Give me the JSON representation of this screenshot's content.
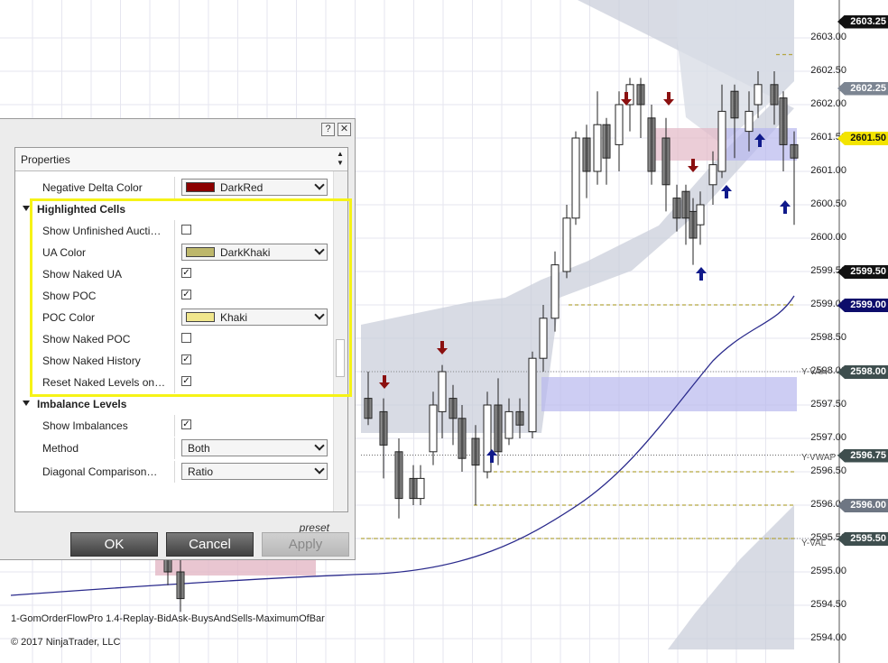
{
  "chart": {
    "price_axis": [
      "2603.00",
      "2602.50",
      "2602.00",
      "2601.50",
      "2601.00",
      "2600.50",
      "2600.00",
      "2599.50",
      "2599.00",
      "2598.50",
      "2598.00",
      "2597.50",
      "2597.00",
      "2596.50",
      "2596.00",
      "2595.50",
      "2595.00",
      "2594.50",
      "2594.00"
    ],
    "price_tags": [
      {
        "label": "2603.25",
        "bg": "#111111",
        "fg": "#ffffff"
      },
      {
        "label": "2602.25",
        "bg": "#7c8592",
        "fg": "#ffffff"
      },
      {
        "label": "2601.50",
        "bg": "#f3e400",
        "fg": "#111111"
      },
      {
        "label": "2599.50",
        "bg": "#111111",
        "fg": "#ffffff"
      },
      {
        "label": "2599.00",
        "bg": "#0d0d6b",
        "fg": "#ffffff"
      },
      {
        "label": "2598.00",
        "bg": "#3e4e4e",
        "fg": "#ffffff"
      },
      {
        "label": "2596.75",
        "bg": "#3e4e4e",
        "fg": "#ffffff"
      },
      {
        "label": "2596.00",
        "bg": "#6e7683",
        "fg": "#ffffff"
      },
      {
        "label": "2595.50",
        "bg": "#3e4e4e",
        "fg": "#ffffff"
      }
    ],
    "levels": {
      "vah": "Y-VAH",
      "vwap": "Y-VWAP",
      "val": "Y-VAL"
    },
    "indicator_label": "1-GomOrderFlowPro 1.4-Replay-BidAsk-BuysAndSells-MaximumOfBar",
    "copyright": "© 2017 NinjaTrader, LLC"
  },
  "dialog": {
    "help_button": "?",
    "close_button": "✕",
    "properties_header": "Properties",
    "rows": [
      {
        "type": "combo",
        "label": "Negative Delta Color",
        "value": "DarkRed",
        "swatch": "#8b0000"
      },
      {
        "type": "category",
        "label": "Highlighted Cells"
      },
      {
        "type": "check",
        "label": "Show Unfinished Aucti…",
        "checked": false
      },
      {
        "type": "combo",
        "label": "UA Color",
        "value": "DarkKhaki",
        "swatch": "#bdb76b"
      },
      {
        "type": "check",
        "label": "Show Naked UA",
        "checked": true
      },
      {
        "type": "check",
        "label": "Show POC",
        "checked": true
      },
      {
        "type": "combo",
        "label": "POC Color",
        "value": "Khaki",
        "swatch": "#f0e68c"
      },
      {
        "type": "check",
        "label": "Show Naked POC",
        "checked": false
      },
      {
        "type": "check",
        "label": "Show Naked History",
        "checked": true
      },
      {
        "type": "check",
        "label": "Reset Naked Levels on…",
        "checked": true
      },
      {
        "type": "category",
        "label": "Imbalance Levels"
      },
      {
        "type": "check",
        "label": "Show Imbalances",
        "checked": true
      },
      {
        "type": "select",
        "label": "Method",
        "value": "Both"
      },
      {
        "type": "select",
        "label": "Diagonal Comparison…",
        "value": "Ratio"
      }
    ],
    "preset": "preset",
    "ok": "OK",
    "cancel": "Cancel",
    "apply": "Apply",
    "highlight_color": "#f6f316"
  }
}
